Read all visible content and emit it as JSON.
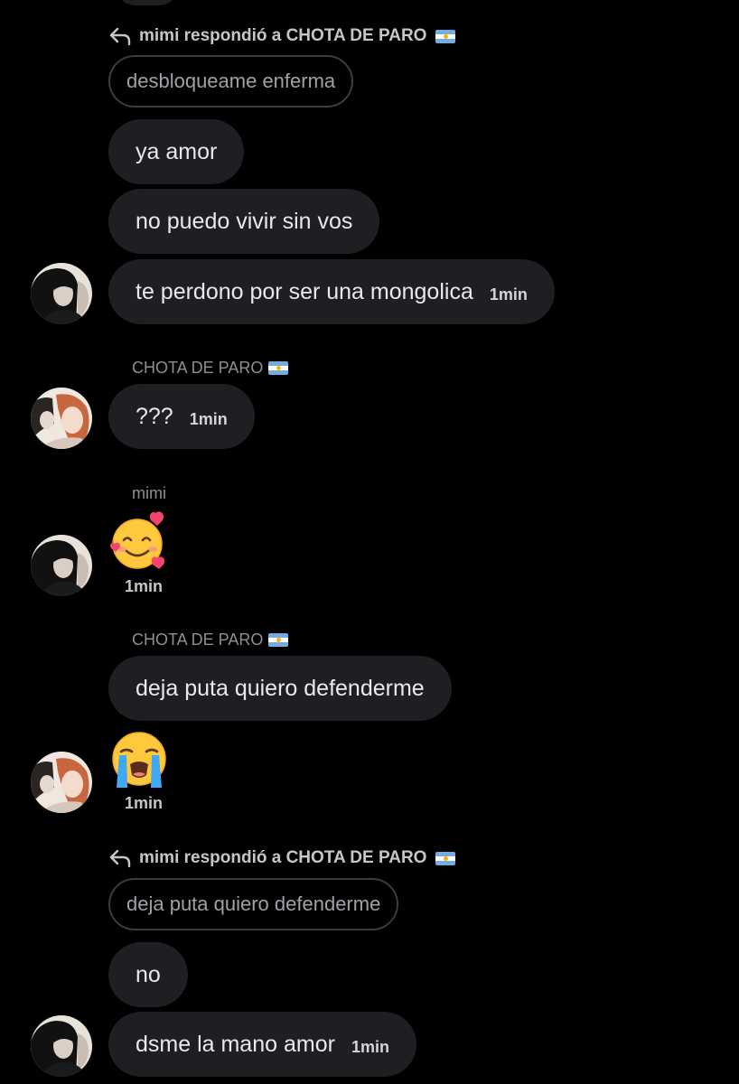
{
  "colors": {
    "background": "#000000",
    "bubble": "#1e1f22",
    "quoted_border": "#3a3c40",
    "text": "#e7e9ea",
    "muted": "#8b8f94"
  },
  "reply_1": {
    "icon": "reply-arrow-icon",
    "label": "mimi respondió a CHOTA DE PARO",
    "flag": "argentina-flag-icon",
    "quoted_text": "desbloqueame enferma"
  },
  "group_1": {
    "avatar": "avatar-mimi",
    "messages": [
      {
        "text": "ya amor"
      },
      {
        "text": "no puedo vivir sin vos"
      },
      {
        "text": "te perdono por ser una mongolica",
        "time": "1min"
      }
    ]
  },
  "group_2": {
    "sender": "CHOTA DE PARO",
    "avatar": "avatar-chota",
    "messages": [
      {
        "text": "???",
        "time": "1min"
      }
    ]
  },
  "group_3": {
    "sender": "mimi",
    "avatar": "avatar-mimi",
    "emoji": "smiling-face-with-hearts-emoji",
    "time": "1min"
  },
  "group_4": {
    "sender": "CHOTA DE PARO",
    "avatar": "avatar-chota",
    "messages": [
      {
        "text": "deja puta quiero defenderme"
      }
    ],
    "emoji": "loudly-crying-face-emoji",
    "time": "1min"
  },
  "reply_2": {
    "icon": "reply-arrow-icon",
    "label": "mimi respondió a CHOTA DE PARO",
    "flag": "argentina-flag-icon",
    "quoted_text": "deja puta quiero defenderme"
  },
  "group_5": {
    "avatar": "avatar-mimi",
    "messages": [
      {
        "text": "no"
      },
      {
        "text": "dsme la mano amor",
        "time": "1min"
      }
    ]
  }
}
